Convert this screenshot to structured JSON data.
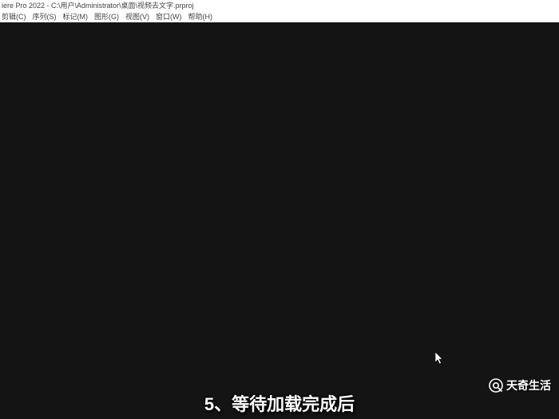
{
  "titlebar": {
    "text": "iere Pro 2022 - C:\\用户\\Administrator\\桌面\\视频去文字.prproj"
  },
  "menubar": {
    "items": [
      {
        "label": "剪辑(C)"
      },
      {
        "label": "序列(S)"
      },
      {
        "label": "标记(M)"
      },
      {
        "label": "图形(G)"
      },
      {
        "label": "视图(V)"
      },
      {
        "label": "窗口(W)"
      },
      {
        "label": "帮助(H)"
      }
    ]
  },
  "caption": {
    "text": "5、等待加载完成后"
  },
  "watermark": {
    "text": "天奇生活"
  }
}
